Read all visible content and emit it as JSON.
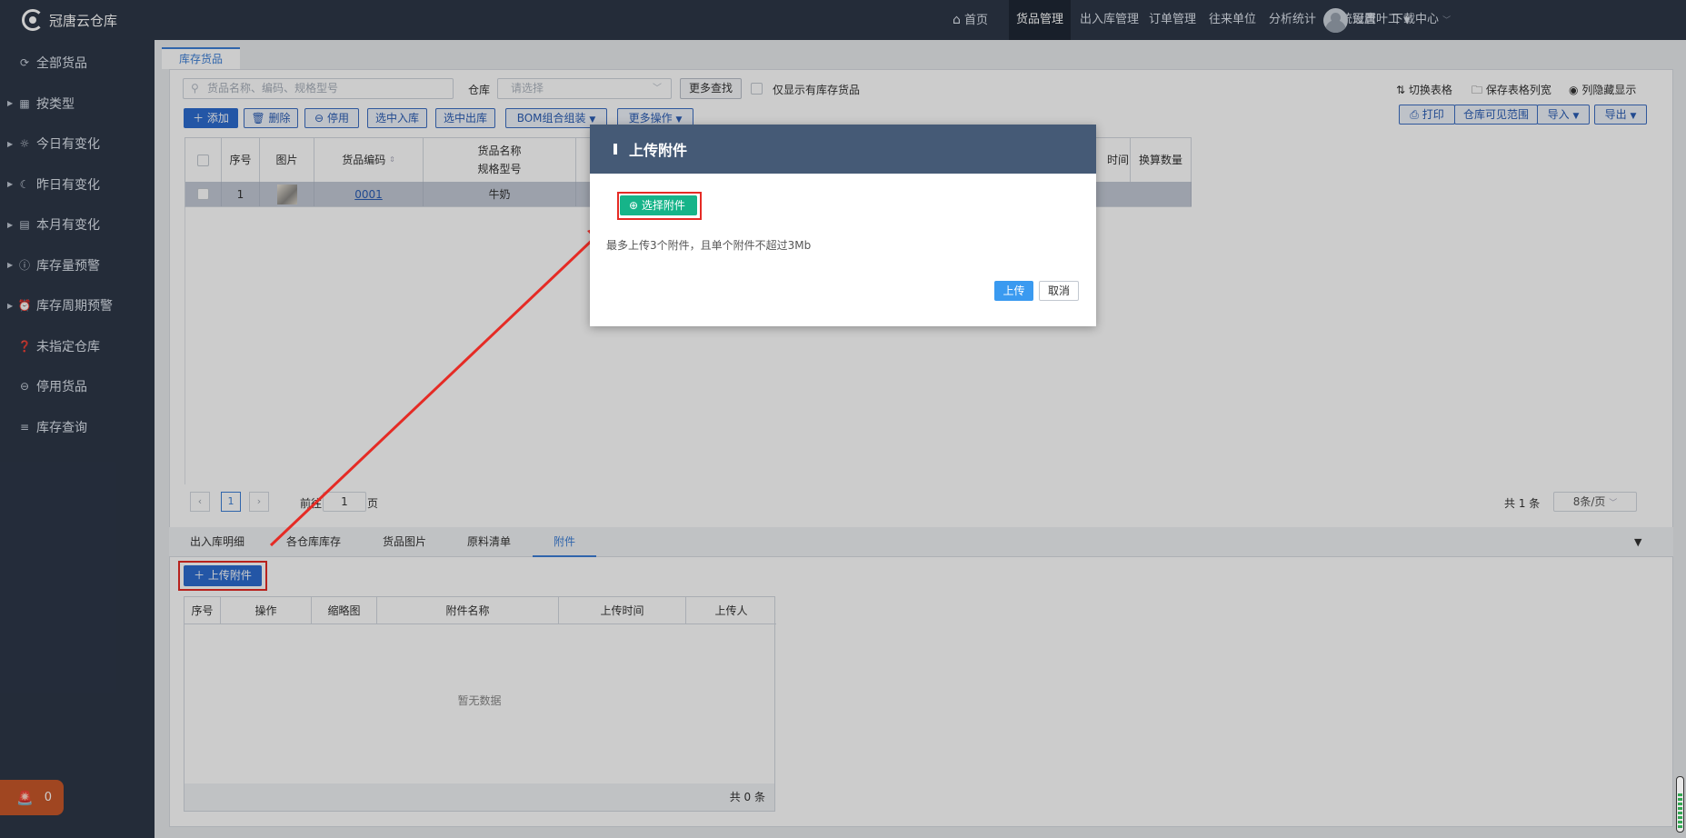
{
  "app": {
    "logo_text": "冠唐云仓库"
  },
  "sidebar": {
    "items": [
      {
        "label": "全部货品",
        "icon": "refresh-icon"
      },
      {
        "label": "按类型",
        "icon": "grid-icon"
      },
      {
        "label": "今日有变化",
        "icon": "sun-icon"
      },
      {
        "label": "昨日有变化",
        "icon": "moon-icon"
      },
      {
        "label": "本月有变化",
        "icon": "calendar-icon"
      },
      {
        "label": "库存量预警",
        "icon": "alert-icon"
      },
      {
        "label": "库存周期预警",
        "icon": "alarm-clock-icon"
      },
      {
        "label": "未指定仓库",
        "icon": "question-icon"
      },
      {
        "label": "停用货品",
        "icon": "minus-circle-icon"
      },
      {
        "label": "库存查询",
        "icon": "list-icon"
      }
    ],
    "alarm_count": "0"
  },
  "topnav": {
    "home": "首页",
    "items": [
      "货品管理",
      "出入库管理",
      "订单管理",
      "往来单位",
      "分析统计",
      "系统设置",
      "下载中心"
    ],
    "active": "货品管理",
    "user": "冠唐叶工"
  },
  "page_tab": "库存货品",
  "toolbar": {
    "search_placeholder": "货品名称、编码、规格型号",
    "warehouse_label": "仓库",
    "warehouse_placeholder": "请选择",
    "more_search": "更多查找",
    "only_stock_label": "仅显示有库存货品",
    "switch_table": "切换表格",
    "save_col_width": "保存表格列宽",
    "col_hide_show": "列隐藏显示",
    "add": "添加",
    "delete": "删除",
    "disable": "停用",
    "selected_in": "选中入库",
    "selected_out": "选中出库",
    "bom": "BOM组合组装",
    "more_ops": "更多操作",
    "print": "打印",
    "warehouse_visible": "仓库可见范围",
    "import": "导入",
    "export": "导出"
  },
  "table": {
    "headers": {
      "seq": "序号",
      "image": "图片",
      "code": "货品编码",
      "name": "货品名称",
      "spec": "规格型号",
      "time_partial": "时间",
      "convert_qty": "换算数量"
    },
    "rows": [
      {
        "seq": "1",
        "code": "0001",
        "name": "牛奶"
      }
    ]
  },
  "pager": {
    "page": "1",
    "goto_prefix": "前往",
    "goto_value": "1",
    "goto_suffix": "页",
    "total": "共 1 条",
    "page_size": "8条/页"
  },
  "bottom_tabs": {
    "items": [
      "出入库明细",
      "各仓库库存",
      "货品图片",
      "原料清单",
      "附件"
    ],
    "active": "附件"
  },
  "attachments": {
    "upload_button": "上传附件",
    "headers": [
      "序号",
      "操作",
      "缩略图",
      "附件名称",
      "上传时间",
      "上传人"
    ],
    "empty": "暂无数据",
    "total": "共 0 条"
  },
  "dialog": {
    "title": "上传附件",
    "choose_button": "选择附件",
    "hint": "最多上传3个附件，且单个附件不超过3Mb",
    "upload": "上传",
    "cancel": "取消"
  },
  "colors": {
    "sidebar": "#2d3748",
    "primary": "#2c6cd0",
    "dialog_header": "#455a76",
    "choose_green": "#16b489",
    "annotation_red": "#e52b25"
  }
}
